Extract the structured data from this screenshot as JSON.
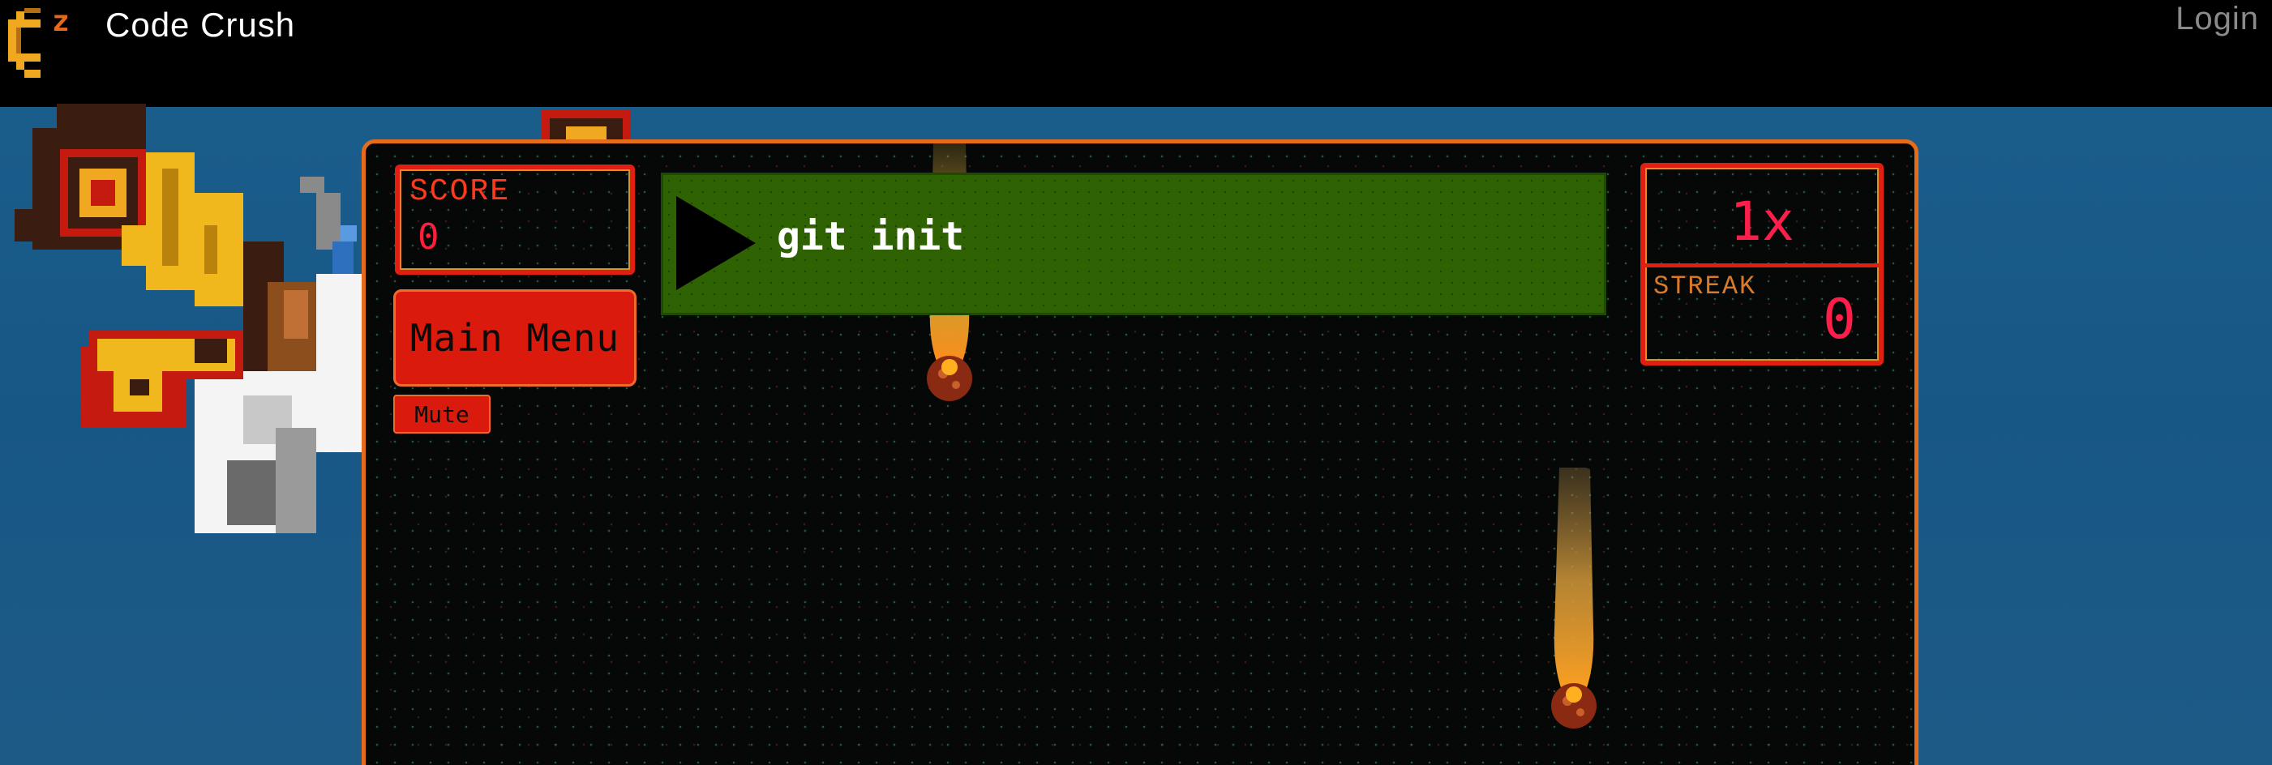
{
  "header": {
    "title": "Code Crush",
    "login_label": "Login",
    "logo_icon": "code-crush-logo-icon"
  },
  "colors": {
    "accent_orange": "#e46c1a",
    "panel_red": "#e01e12",
    "command_green": "#2e6203",
    "score_red": "#ff1e3c"
  },
  "game": {
    "score_label": "SCORE",
    "score_value": "0",
    "main_menu_label": "Main Menu",
    "mute_label": "Mute",
    "command": "git init",
    "play_icon": "play-icon",
    "multiplier": "1x",
    "streak_label": "STREAK",
    "streak_value": "0"
  }
}
